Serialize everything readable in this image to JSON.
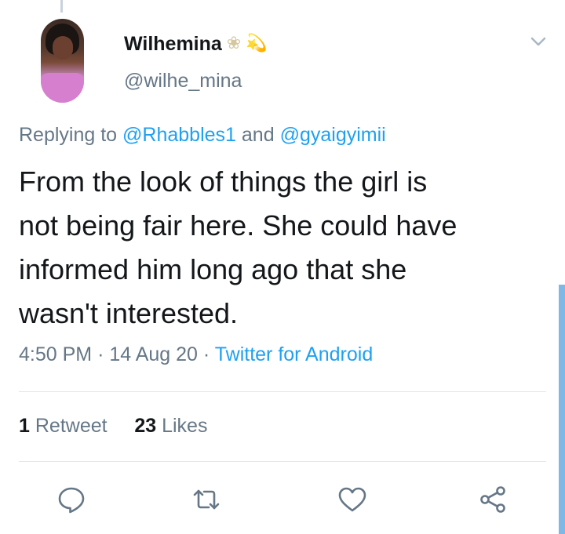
{
  "tweet": {
    "author": {
      "display_name": "Wilhemina",
      "name_emojis": [
        "❀",
        "💫"
      ],
      "handle": "@wilhe_mina"
    },
    "replying_prefix": "Replying to",
    "reply_mentions": [
      "@Rhabbles1",
      "@gyaigyimii"
    ],
    "reply_joiner": "and",
    "text": "From the look of things the girl is\nnot being fair here. She could have\ninformed him long ago that she\nwasn't interested.",
    "time": "4:50 PM",
    "date": "14 Aug 20",
    "separator": "·",
    "source": "Twitter for Android",
    "retweet_count": "1",
    "retweet_label": "Retweet",
    "like_count": "23",
    "like_label": "Likes"
  },
  "icons": {
    "menu": "chevron-down-icon",
    "reply": "reply-icon",
    "retweet": "retweet-icon",
    "like": "heart-icon",
    "share": "share-icon"
  },
  "colors": {
    "accent": "#1da1f2",
    "secondary_text": "#657786",
    "primary_text": "#14171a",
    "icon_gray": "#657786",
    "divider": "#e1e8ed",
    "scrollbar": "#7db8e6"
  }
}
